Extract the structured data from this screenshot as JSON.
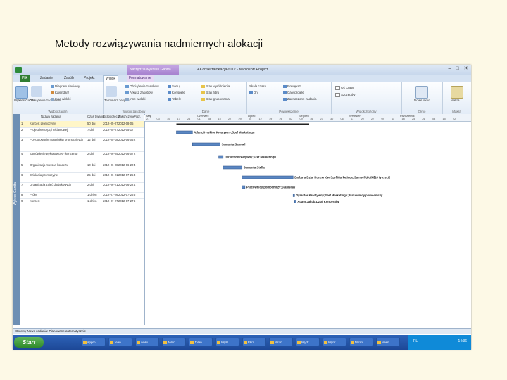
{
  "slide": {
    "title": "Metody rozwiązywania nadmiernych alokacji"
  },
  "window": {
    "title": "AKcnsertalokacja2012 - Microsoft Project",
    "contextual_tab": "Narzędzia wykresu Gantta",
    "min": "–",
    "max": "□",
    "close": "✕"
  },
  "tabs": [
    {
      "label": "Plik"
    },
    {
      "label": "Zadanie"
    },
    {
      "label": "Zasób"
    },
    {
      "label": "Projekt"
    },
    {
      "label": "Widok"
    },
    {
      "label": "Formatowanie"
    }
  ],
  "ribbon": {
    "groups": [
      {
        "label": "Widoki zadań",
        "items": [
          "Wykres Gantta",
          "Obciążenie zadaniami",
          "Diagram sieciowy",
          "Kalendarz",
          "Inne widoki"
        ]
      },
      {
        "label": "Widoki zasobów",
        "items": [
          "Terminarz zespołu",
          "Obciążenie zasobów",
          "Arkusz zasobów",
          "Inne widoki"
        ]
      },
      {
        "label": "Dane",
        "items": [
          "Sortuj",
          "Konspekt",
          "Tabele",
          "Brak wyróżnienia",
          "Brak filtru",
          "Brak grupowania"
        ]
      },
      {
        "label": "Powiększenie",
        "items": [
          "Skala czasu",
          "Dni",
          "Powiększ",
          "Cały projekt",
          "Zaznaczone zadania"
        ]
      },
      {
        "label": "Widok złożony",
        "items": [
          "Oś czasu",
          "Szczegóły"
        ]
      },
      {
        "label": "Okno",
        "items": [
          "Nowe okno"
        ]
      },
      {
        "label": "Makra",
        "items": [
          "Makra"
        ]
      }
    ]
  },
  "side_pane": {
    "label": "Wykres Gantta"
  },
  "grid": {
    "headers": [
      "",
      "Nazwa zadania",
      "Czas trwania",
      "Rozpoczęcie",
      "Zakończenie",
      "Popr."
    ],
    "rows": [
      {
        "id": "1",
        "name": "Koncert promocyjny",
        "duration": "50 dni",
        "start": "2012-05-07",
        "finish": "2012-08-05",
        "pred": ""
      },
      {
        "id": "2",
        "name": "Projekt koncepcji reklamowej",
        "duration": "7 dni",
        "start": "2012-05-07",
        "finish": "2012-05-17",
        "pred": ""
      },
      {
        "id": "3",
        "name": "Przygotowanie materiałów promocyjnych",
        "duration": "12 dni",
        "start": "2012-05-18",
        "finish": "2012-06-05",
        "pred": "2"
      },
      {
        "id": "4",
        "name": "Zamówienie wykonawców (koncertu)",
        "duration": "2 dni",
        "start": "2012-06-05",
        "finish": "2012-06-07",
        "pred": "2"
      },
      {
        "id": "5",
        "name": "Organizacja miejsca koncertu",
        "duration": "10 dni",
        "start": "2012-06-08",
        "finish": "2012-06-20",
        "pred": "4"
      },
      {
        "id": "6",
        "name": "Działania promocyjne",
        "duration": "25 dni",
        "start": "2012-06-21",
        "finish": "2012-07-25",
        "pred": "3"
      },
      {
        "id": "7",
        "name": "Organizacja zajęć dodatkowych",
        "duration": "2 dni",
        "start": "2012-06-21",
        "finish": "2012-06-22",
        "pred": "4"
      },
      {
        "id": "8",
        "name": "Próby",
        "duration": "1 dzień",
        "start": "2012-07-26",
        "finish": "2012-07-26",
        "pred": "6"
      },
      {
        "id": "9",
        "name": "Koncert",
        "duration": "1 dzień",
        "start": "2012-07-27",
        "finish": "2012-07-27",
        "pred": "6"
      }
    ]
  },
  "timescale": {
    "weeks": [
      "Maj",
      "Czerwiec",
      "Lipiec",
      "Sierpień",
      "Wrzesień",
      "Październik"
    ],
    "days": [
      "27",
      "03",
      "10",
      "17",
      "24",
      "01",
      "08",
      "15",
      "22",
      "29",
      "05",
      "12",
      "19",
      "26",
      "02",
      "09",
      "16",
      "23",
      "30",
      "06",
      "13",
      "20",
      "27",
      "04",
      "11",
      "18",
      "25",
      "01",
      "08",
      "15",
      "22"
    ]
  },
  "gantt": [
    {
      "label": "Adam;Dyrektor Kreatywny;Szef Marketingu",
      "row": 1
    },
    {
      "label": "Samanta;Samuel",
      "row": 2
    },
    {
      "label": "Dyrektor Kreatywny;Szef Marketingu",
      "row": 3
    },
    {
      "label": "Samanta;Stella",
      "row": 4
    },
    {
      "label": "Barbara;Dział Koncertów;Szef Marketingu;Samuel;Ulotki[10 tys. szt]",
      "row": 5
    },
    {
      "label": "Pracownicy pomocniczy;Stanisław",
      "row": 6
    },
    {
      "label": "Dyrektor Kreatywny;Szef Marketingu;Pracownicy pomocniczy",
      "row": 7
    },
    {
      "label": "Adam;Jakub;Dział Koncertów",
      "row": 8
    }
  ],
  "status": {
    "text": "Gotowy   Nowe zadania: Planowane automatycznie"
  },
  "taskbar": {
    "start": "Start",
    "buttons": [
      "appro...",
      "Jean...",
      "www...",
      "Jolan...",
      "Jolan...",
      "Wyśl...",
      "Ekra...",
      "Wron...",
      "Wydr...",
      "Wydr...",
      "Micro...",
      "Miwn..."
    ],
    "lang": "PL",
    "time": "14:36"
  }
}
